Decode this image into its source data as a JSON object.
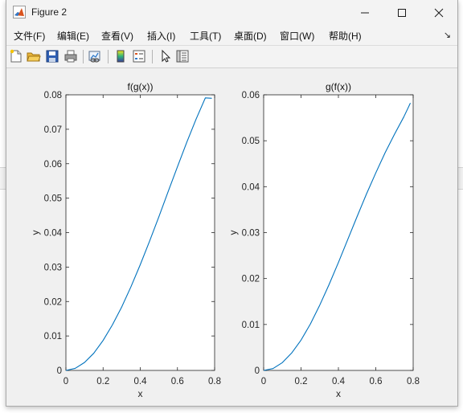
{
  "window": {
    "title": "Figure 2"
  },
  "window_controls": {
    "minimize": "—",
    "maximize": "☐",
    "close": "✕"
  },
  "menu": {
    "items": [
      {
        "label": "文件(F)"
      },
      {
        "label": "编辑(E)"
      },
      {
        "label": "查看(V)"
      },
      {
        "label": "插入(I)"
      },
      {
        "label": "工具(T)"
      },
      {
        "label": "桌面(D)"
      },
      {
        "label": "窗口(W)"
      },
      {
        "label": "帮助(H)"
      }
    ],
    "overflow_arrow": "↘"
  },
  "toolbar": {
    "buttons": [
      {
        "icon": "new-figure-icon"
      },
      {
        "icon": "open-file-icon"
      },
      {
        "icon": "save-icon"
      },
      {
        "icon": "print-icon"
      },
      {
        "icon": "link-plot-icon"
      },
      {
        "icon": "colorbar-icon"
      },
      {
        "icon": "legend-icon"
      },
      {
        "icon": "edit-plot-cursor-icon"
      },
      {
        "icon": "property-inspector-icon"
      }
    ]
  },
  "colors": {
    "line": "#0072BD",
    "axes_bg": "#ffffff",
    "figure_bg": "#f0f0f0"
  },
  "chart_data": [
    {
      "type": "line",
      "title": "f(g(x))",
      "xlabel": "x",
      "ylabel": "y",
      "xlim": [
        0,
        0.8
      ],
      "ylim": [
        0,
        0.08
      ],
      "x_ticks": [
        "0",
        "0.2",
        "0.4",
        "0.6",
        "0.8"
      ],
      "y_ticks": [
        "0",
        "0.01",
        "0.02",
        "0.03",
        "0.04",
        "0.05",
        "0.06",
        "0.07",
        "0.08"
      ],
      "series": [
        {
          "x": [
            0,
            0.05,
            0.1,
            0.15,
            0.2,
            0.25,
            0.3,
            0.35,
            0.4,
            0.45,
            0.5,
            0.55,
            0.6,
            0.65,
            0.7,
            0.75,
            0.785
          ],
          "y": [
            0,
            0.0006,
            0.0023,
            0.005,
            0.0087,
            0.0132,
            0.0184,
            0.0243,
            0.0307,
            0.0375,
            0.0446,
            0.0519,
            0.0591,
            0.0662,
            0.0729,
            0.0791,
            0.079
          ]
        }
      ]
    },
    {
      "type": "line",
      "title": "g(f(x))",
      "xlabel": "x",
      "ylabel": "y",
      "xlim": [
        0,
        0.8
      ],
      "ylim": [
        0,
        0.06
      ],
      "x_ticks": [
        "0",
        "0.2",
        "0.4",
        "0.6",
        "0.8"
      ],
      "y_ticks": [
        "0",
        "0.01",
        "0.02",
        "0.03",
        "0.04",
        "0.05",
        "0.06"
      ],
      "series": [
        {
          "x": [
            0,
            0.05,
            0.1,
            0.15,
            0.2,
            0.25,
            0.3,
            0.35,
            0.4,
            0.45,
            0.5,
            0.55,
            0.6,
            0.65,
            0.7,
            0.75,
            0.785
          ],
          "y": [
            0,
            0.0004,
            0.0017,
            0.0038,
            0.0066,
            0.0101,
            0.0142,
            0.0187,
            0.0235,
            0.0285,
            0.0335,
            0.0384,
            0.043,
            0.0474,
            0.0514,
            0.0552,
            0.0582
          ]
        }
      ]
    }
  ]
}
